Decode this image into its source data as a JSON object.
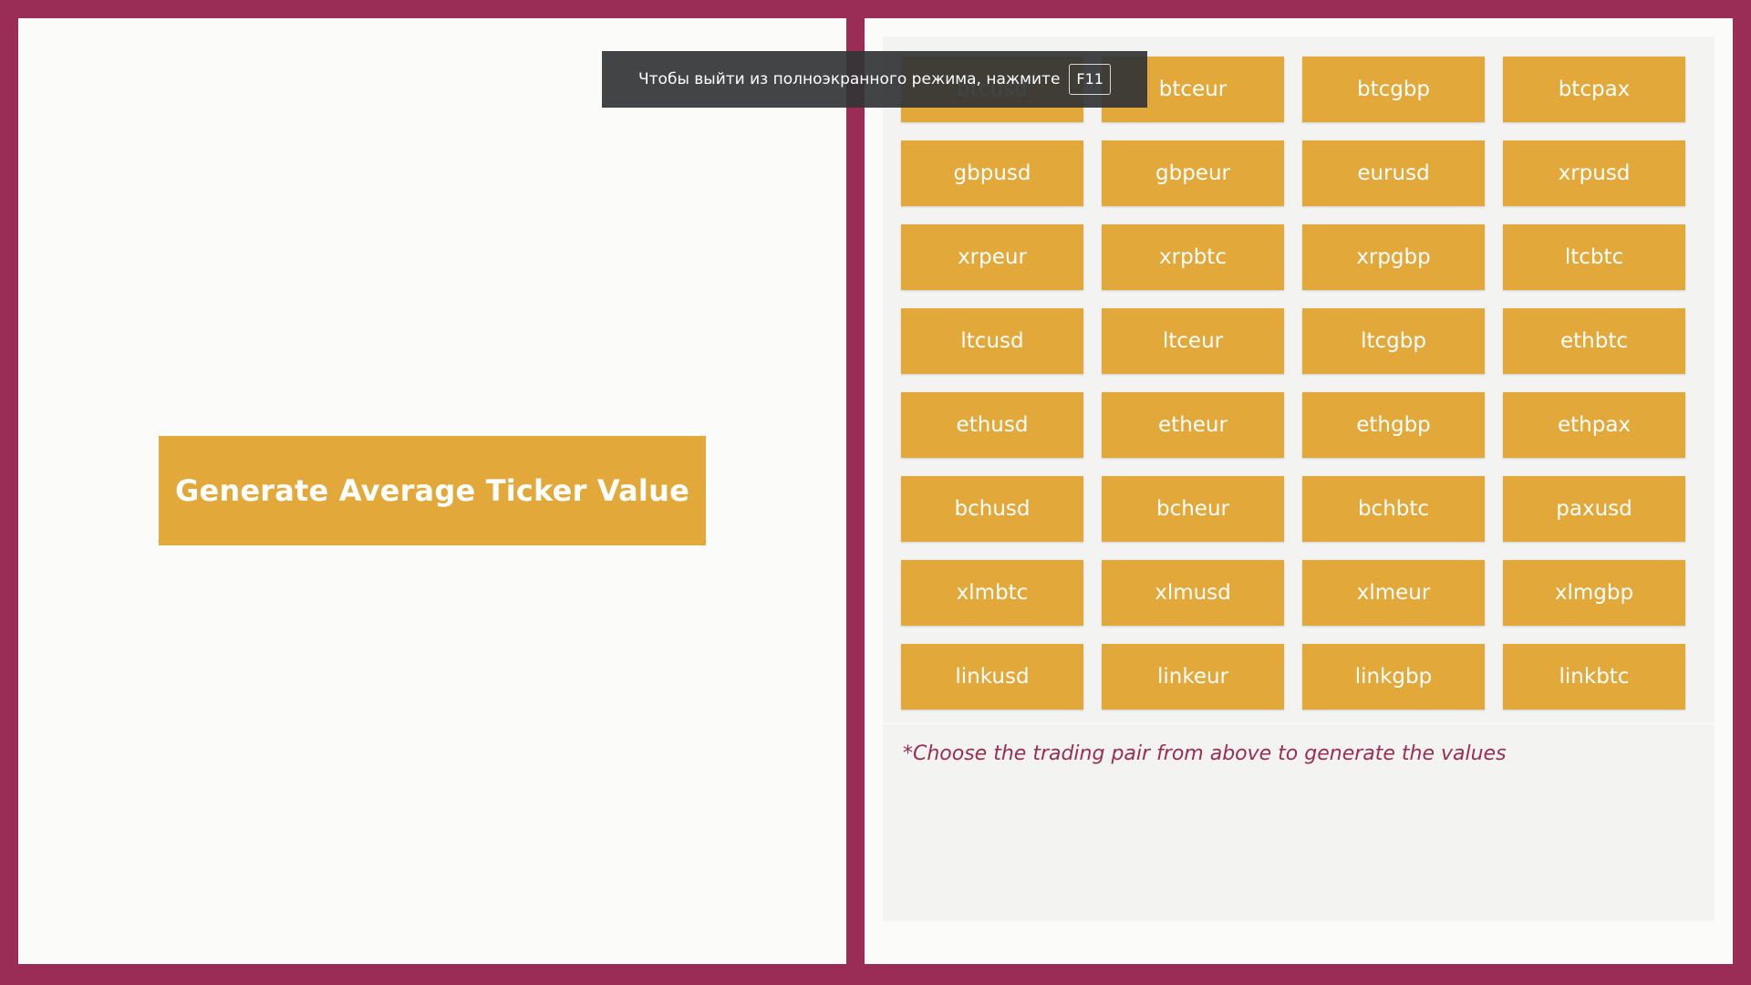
{
  "generate_button": {
    "label": "Generate Average Ticker Value"
  },
  "pairs": [
    "btcusd",
    "btceur",
    "btcgbp",
    "btcpax",
    "gbpusd",
    "gbpeur",
    "eurusd",
    "xrpusd",
    "xrpeur",
    "xrpbtc",
    "xrpgbp",
    "ltcbtc",
    "ltcusd",
    "ltceur",
    "ltcgbp",
    "ethbtc",
    "ethusd",
    "etheur",
    "ethgbp",
    "ethpax",
    "bchusd",
    "bcheur",
    "bchbtc",
    "paxusd",
    "xlmbtc",
    "xlmusd",
    "xlmeur",
    "xlmgbp",
    "linkusd",
    "linkeur",
    "linkgbp",
    "linkbtc"
  ],
  "result": {
    "hint": "*Choose the trading pair from above to generate the values"
  },
  "fullscreen_toast": {
    "message": "Чтобы выйти из полноэкранного режима, нажмите",
    "key": "F11"
  },
  "colors": {
    "frame": "#9a2d55",
    "panel": "#fbfbf9",
    "button": "#e2a83a",
    "hint_text": "#9a2d55"
  }
}
